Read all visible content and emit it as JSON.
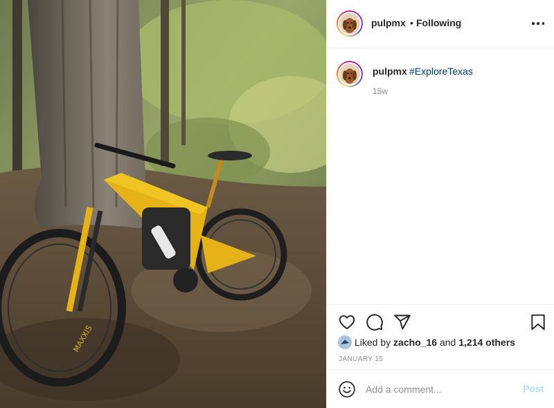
{
  "post": {
    "author": "pulpmx",
    "follow_separator": "•",
    "follow_status": "Following",
    "caption_hashtag": "#ExploreTexas",
    "age": "15w",
    "liked_by_prefix": "Liked by",
    "liked_by_user": "zacho_16",
    "liked_by_and": "and",
    "liked_by_others": "1,214 others",
    "date": "JANUARY 15"
  },
  "comment": {
    "placeholder": "Add a comment...",
    "post_label": "Post"
  },
  "colors": {
    "link": "#00376b",
    "post_button_disabled": "#b2dffc",
    "muted_text": "#8e8e8e",
    "bike_accent": "#e5b318"
  },
  "icons": {
    "more": "more-options-icon",
    "like": "heart-icon",
    "comment": "comment-icon",
    "share": "paper-plane-icon",
    "save": "bookmark-icon",
    "emoji": "smiley-icon"
  }
}
